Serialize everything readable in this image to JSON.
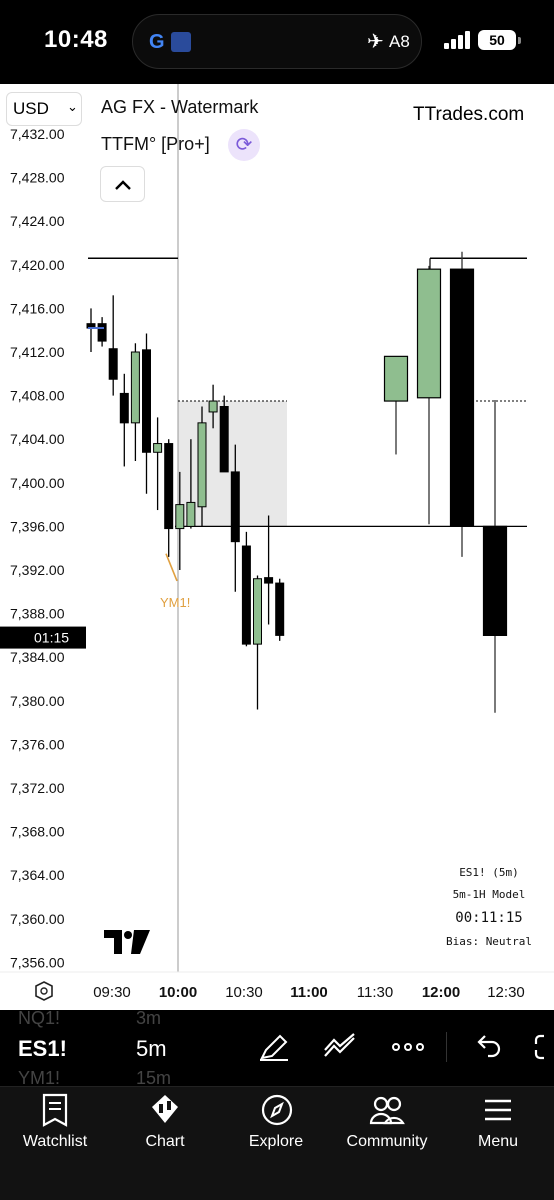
{
  "status": {
    "time": "10:48",
    "flight_code": "A8",
    "battery": "50",
    "signal_bars": 4
  },
  "chart_header": {
    "currency": "USD",
    "indicator_1": "AG FX - Watermark",
    "indicator_2": "TTFM° [Pro+]",
    "watermark": "TTrades.com"
  },
  "info_panel": {
    "symbol_interval": "ES1! (5m)",
    "model": "5m-1H Model",
    "timer": "00:11:15",
    "bias": "Bias: Neutral"
  },
  "ylabels": [
    "7,432.00",
    "7,428.00",
    "7,424.00",
    "7,420.00",
    "7,416.00",
    "7,412.00",
    "7,408.00",
    "7,404.00",
    "7,400.00",
    "7,396.00",
    "7,392.00",
    "7,388.00",
    "7,384.00",
    "7,380.00",
    "7,376.00",
    "7,372.00",
    "7,368.00",
    "7,364.00",
    "7,360.00",
    "7,356.00"
  ],
  "countdown_label": "01:15",
  "annotation_label": "YM1!",
  "xlabels": [
    {
      "text": "09:30",
      "bold": false
    },
    {
      "text": "10:00",
      "bold": true
    },
    {
      "text": "10:30",
      "bold": false
    },
    {
      "text": "11:00",
      "bold": true
    },
    {
      "text": "11:30",
      "bold": false
    },
    {
      "text": "12:00",
      "bold": true
    },
    {
      "text": "12:30",
      "bold": false
    }
  ],
  "colors": {
    "bull": "#8fbe8f",
    "bear": "#000000",
    "annotation": "#e0a040",
    "zone": "#e8e8e8"
  },
  "chart_data": {
    "type": "candlestick",
    "symbol": "ES1!",
    "interval": "5m",
    "y_range": [
      7354.5,
      7432.5
    ],
    "candles_ltf": [
      {
        "o": 7414.6,
        "h": 7416.0,
        "l": 7412.0,
        "c": 7414.2
      },
      {
        "o": 7414.6,
        "h": 7415.2,
        "l": 7412.5,
        "c": 7413.0
      },
      {
        "o": 7412.3,
        "h": 7417.2,
        "l": 7408.0,
        "c": 7409.5
      },
      {
        "o": 7408.2,
        "h": 7410.0,
        "l": 7401.5,
        "c": 7405.5
      },
      {
        "o": 7405.5,
        "h": 7412.8,
        "l": 7402.0,
        "c": 7412.0
      },
      {
        "o": 7412.2,
        "h": 7413.7,
        "l": 7399.0,
        "c": 7402.8
      },
      {
        "o": 7402.8,
        "h": 7406.0,
        "l": 7397.5,
        "c": 7403.6
      },
      {
        "o": 7403.6,
        "h": 7404.0,
        "l": 7393.2,
        "c": 7395.8
      },
      {
        "o": 7395.8,
        "h": 7401.0,
        "l": 7392.0,
        "c": 7398.0
      },
      {
        "o": 7396.0,
        "h": 7404.0,
        "l": 7395.8,
        "c": 7398.2
      },
      {
        "o": 7397.8,
        "h": 7407.0,
        "l": 7396.0,
        "c": 7405.5
      },
      {
        "o": 7406.5,
        "h": 7409.0,
        "l": 7405.0,
        "c": 7407.5
      },
      {
        "o": 7407.0,
        "h": 7408.0,
        "l": 7401.0,
        "c": 7401.0
      },
      {
        "o": 7401.0,
        "h": 7403.5,
        "l": 7390.0,
        "c": 7394.6
      },
      {
        "o": 7394.2,
        "h": 7395.5,
        "l": 7385.0,
        "c": 7385.2
      },
      {
        "o": 7385.2,
        "h": 7391.5,
        "l": 7379.2,
        "c": 7391.2
      },
      {
        "o": 7391.3,
        "h": 7397.0,
        "l": 7387.0,
        "c": 7390.8
      },
      {
        "o": 7390.8,
        "h": 7391.2,
        "l": 7385.5,
        "c": 7386.0
      }
    ],
    "candles_htf": [
      {
        "o": 7407.5,
        "h": 7409.5,
        "l": 7402.6,
        "c": 7411.6
      },
      {
        "o": 7407.8,
        "h": 7419.9,
        "l": 7396.2,
        "c": 7419.6
      },
      {
        "o": 7419.6,
        "h": 7421.2,
        "l": 7393.2,
        "c": 7396.0
      },
      {
        "o": 7396.0,
        "h": 7407.6,
        "l": 7378.9,
        "c": 7386.0
      }
    ],
    "levels": {
      "high_line": 7420.6,
      "zone_top": 7407.5,
      "zone_bottom": 7396.0,
      "mid_line": 7396.0,
      "dotted_right": 7407.5,
      "current_marker": 7385.8
    }
  },
  "toolbar": {
    "symbol": "ES1!",
    "interval": "5m",
    "ghost_symbol_above": "NQ1!",
    "ghost_symbol_below": "YM1!",
    "ghost_interval_above": "3m",
    "ghost_interval_below": "15m"
  },
  "nav": {
    "items": [
      {
        "label": "Watchlist",
        "icon": "watchlist-icon"
      },
      {
        "label": "Chart",
        "icon": "chart-icon"
      },
      {
        "label": "Explore",
        "icon": "compass-icon"
      },
      {
        "label": "Community",
        "icon": "community-icon"
      },
      {
        "label": "Menu",
        "icon": "menu-icon"
      }
    ]
  }
}
